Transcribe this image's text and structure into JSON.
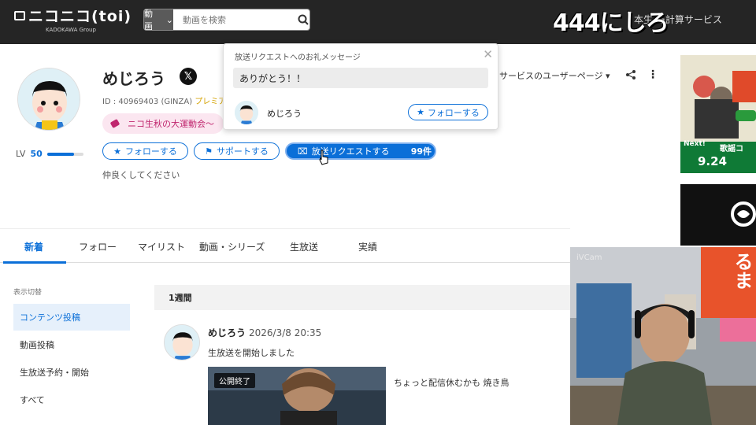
{
  "header": {
    "logo_text": "ニコニコ(toi)",
    "logo_sub": "KADOKAWA Group",
    "search_category": "動画",
    "search_placeholder": "動画を検索",
    "overlay_count": "444にしろ",
    "right_menu": "本生 与計算サービス"
  },
  "profile": {
    "name": "めじろう",
    "user_id_line": "ID : 40969403 (GINZA) ",
    "premium_label": "プレミア",
    "event_badge": "ニコ生秋の大運動会〜",
    "level_label": "LV",
    "level_value": "50",
    "level_progress": 0.75,
    "follow_label": "フォローする",
    "support_label": "サポートする",
    "request_label": "放送リクエストする",
    "request_count": "99件",
    "description": "仲良くしてください",
    "service_link": "サービスのユーザーページ ▾"
  },
  "popup": {
    "title": "放送リクエストへのお礼メッセージ",
    "message": "ありがとう！！",
    "name": "めじろう",
    "follow_label": "フォローする"
  },
  "tabs": [
    "新着",
    "フォロー",
    "マイリスト",
    "動画・シリーズ",
    "生放送",
    "実績"
  ],
  "sidebar": {
    "heading": "表示切替",
    "items": [
      "コンテンツ投稿",
      "動画投稿",
      "生放送予約・開始",
      "すべて"
    ]
  },
  "feed": {
    "period": "1週間",
    "post_name": "めじろう",
    "post_date": "2026/3/8 20:35",
    "post_text": "生放送を開始しました",
    "thumb_badge": "公開終了",
    "item_title": "ちょっと配信休むかも 焼き鳥"
  },
  "ad": {
    "date_text": "9.24",
    "next_label": "Next!",
    "side_text": "歌謡コ"
  },
  "camera": {
    "label": "iVCam",
    "sign_text": "るま"
  },
  "colors": {
    "accent": "#0b6fd8",
    "topbar": "#252525"
  }
}
